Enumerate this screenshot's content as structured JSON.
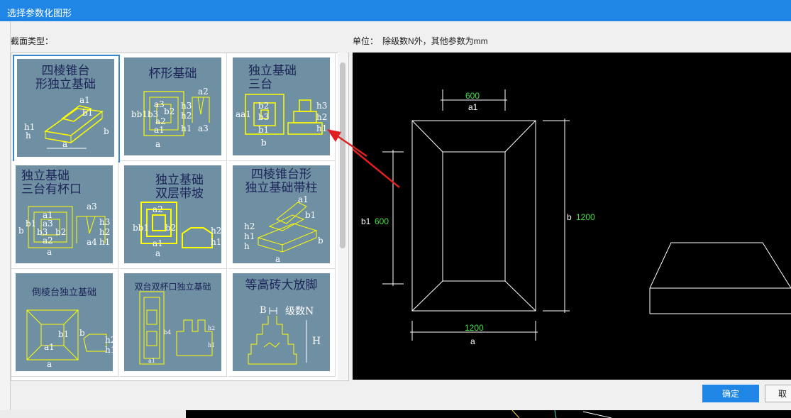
{
  "dialog": {
    "title": "选择参数化图形",
    "section_label": "截面类型：",
    "unit_label": "单位：",
    "unit_text": "除级数N外，其他参数为mm",
    "ok_label": "确定",
    "cancel_label": "取"
  },
  "shapes": [
    {
      "title": "四棱锥台\n形独立基础",
      "selected": true
    },
    {
      "title": "杯形基础",
      "selected": false
    },
    {
      "title": "独立基础\n三台",
      "selected": false
    },
    {
      "title": "独立基础\n三台有杯口",
      "selected": false
    },
    {
      "title": "独立基础\n双层带坡",
      "selected": false
    },
    {
      "title": "四棱锥台形\n独立基础带柱",
      "selected": false
    },
    {
      "title": "倒棱台独立基础",
      "selected": false
    },
    {
      "title": "双台双杯口独立基础",
      "selected": false
    },
    {
      "title": "等高砖大放脚",
      "selected": false
    }
  ],
  "preview": {
    "dim_a1": "600",
    "label_a1": "a1",
    "label_b1": "b1",
    "dim_b1": "600",
    "label_b": "b",
    "dim_b": "1200",
    "dim_a": "1200",
    "label_a": "a"
  },
  "colors": {
    "accent": "#1f86e6",
    "thumb_bg": "#6f8fa3",
    "dim_green": "#3ee03e"
  }
}
